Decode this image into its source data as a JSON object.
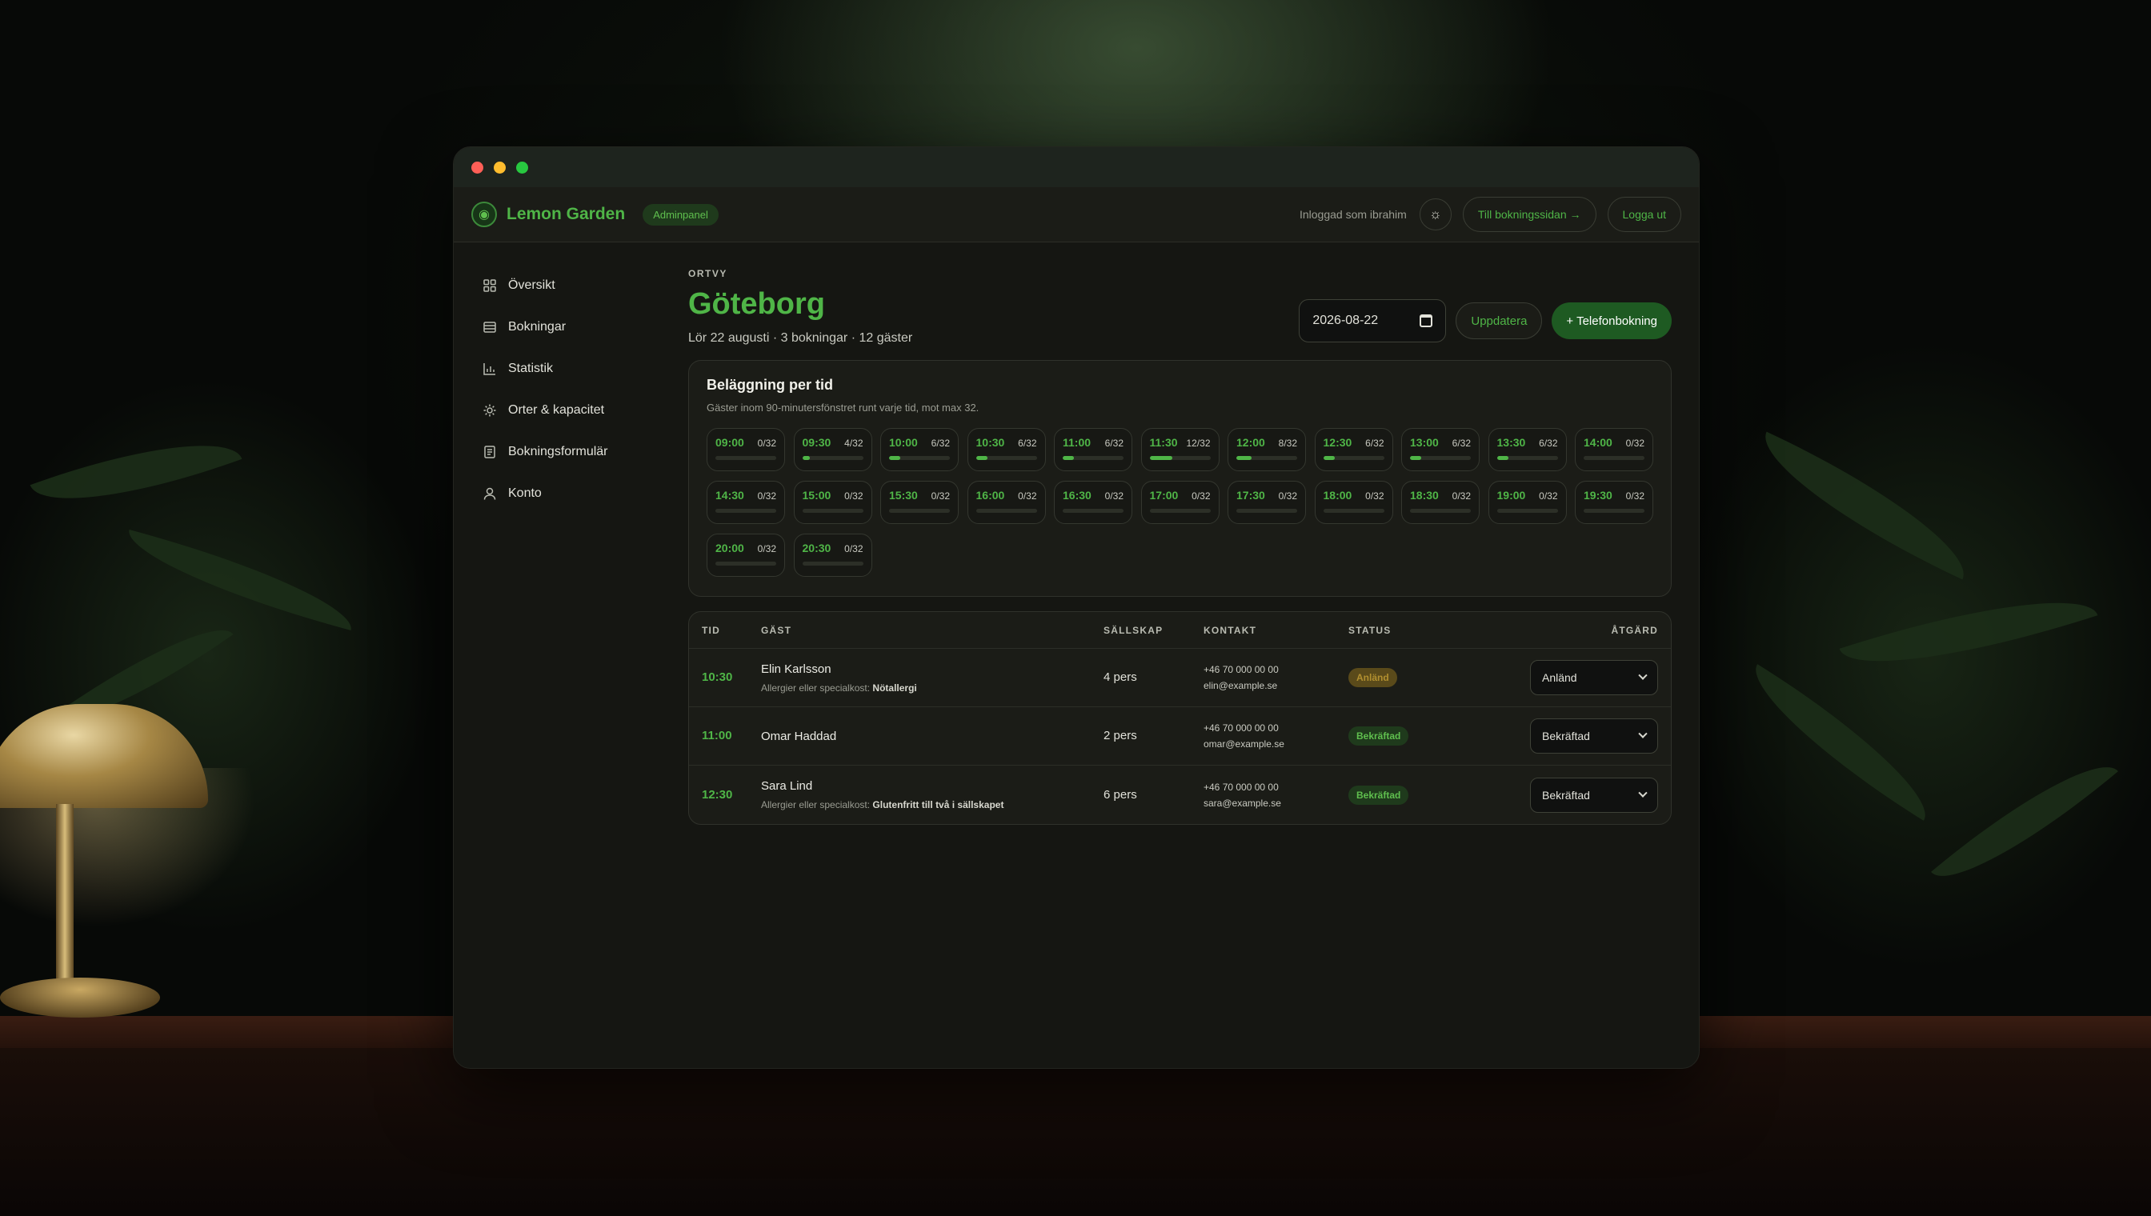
{
  "app": {
    "brand_name": "Lemon Garden",
    "brand_badge": "Adminpanel",
    "logged_in_text": "Inloggad som ibrahim",
    "to_booking_label": "Till bokningssidan →",
    "logout_label": "Logga ut"
  },
  "sidebar": {
    "items": [
      {
        "label": "Översikt",
        "icon": "grid-icon"
      },
      {
        "label": "Bokningar",
        "icon": "list-icon"
      },
      {
        "label": "Statistik",
        "icon": "chart-icon"
      },
      {
        "label": "Orter & kapacitet",
        "icon": "gear-icon"
      },
      {
        "label": "Bokningsformulär",
        "icon": "form-icon"
      },
      {
        "label": "Konto",
        "icon": "user-icon"
      }
    ]
  },
  "page": {
    "eyebrow": "ORTVY",
    "title": "Göteborg",
    "subtitle": "Lör 22 augusti · 3 bokningar · 12 gäster",
    "date_value": "2026-08-22",
    "refresh_label": "Uppdatera",
    "phone_booking_label": "+ Telefonbokning"
  },
  "capacity": {
    "title": "Beläggning per tid",
    "subtitle": "Gäster inom 90-minutersfönstret runt varje tid, mot max 32.",
    "max": 32,
    "slots": [
      {
        "time": "09:00",
        "count": "0/32",
        "guests": 0
      },
      {
        "time": "09:30",
        "count": "4/32",
        "guests": 4
      },
      {
        "time": "10:00",
        "count": "6/32",
        "guests": 6
      },
      {
        "time": "10:30",
        "count": "6/32",
        "guests": 6
      },
      {
        "time": "11:00",
        "count": "6/32",
        "guests": 6
      },
      {
        "time": "11:30",
        "count": "12/32",
        "guests": 12
      },
      {
        "time": "12:00",
        "count": "8/32",
        "guests": 8
      },
      {
        "time": "12:30",
        "count": "6/32",
        "guests": 6
      },
      {
        "time": "13:00",
        "count": "6/32",
        "guests": 6
      },
      {
        "time": "13:30",
        "count": "6/32",
        "guests": 6
      },
      {
        "time": "14:00",
        "count": "0/32",
        "guests": 0
      },
      {
        "time": "14:30",
        "count": "0/32",
        "guests": 0
      },
      {
        "time": "15:00",
        "count": "0/32",
        "guests": 0
      },
      {
        "time": "15:30",
        "count": "0/32",
        "guests": 0
      },
      {
        "time": "16:00",
        "count": "0/32",
        "guests": 0
      },
      {
        "time": "16:30",
        "count": "0/32",
        "guests": 0
      },
      {
        "time": "17:00",
        "count": "0/32",
        "guests": 0
      },
      {
        "time": "17:30",
        "count": "0/32",
        "guests": 0
      },
      {
        "time": "18:00",
        "count": "0/32",
        "guests": 0
      },
      {
        "time": "18:30",
        "count": "0/32",
        "guests": 0
      },
      {
        "time": "19:00",
        "count": "0/32",
        "guests": 0
      },
      {
        "time": "19:30",
        "count": "0/32",
        "guests": 0
      },
      {
        "time": "20:00",
        "count": "0/32",
        "guests": 0
      },
      {
        "time": "20:30",
        "count": "0/32",
        "guests": 0
      }
    ]
  },
  "bookings": {
    "headers": [
      "TID",
      "GÄST",
      "SÄLLSKAP",
      "KONTAKT",
      "STATUS",
      "ÅTGÄRD"
    ],
    "rows": [
      {
        "time": "10:30",
        "guest": "Elin Karlsson",
        "note_label": "Allergier eller specialkost:",
        "note_value": "Nötallergi",
        "party": "4 pers",
        "phone": "+46 70 000 00 00",
        "email": "elin@example.se",
        "status": "Anländ",
        "status_kind": "arrived",
        "action": "Anländ"
      },
      {
        "time": "11:00",
        "guest": "Omar Haddad",
        "note_label": "",
        "note_value": "",
        "party": "2 pers",
        "phone": "+46 70 000 00 00",
        "email": "omar@example.se",
        "status": "Bekräftad",
        "status_kind": "confirmed",
        "action": "Bekräftad"
      },
      {
        "time": "12:30",
        "guest": "Sara Lind",
        "note_label": "Allergier eller specialkost:",
        "note_value": "Glutenfritt till två i sällskapet",
        "party": "6 pers",
        "phone": "+46 70 000 00 00",
        "email": "sara@example.se",
        "status": "Bekräftad",
        "status_kind": "confirmed",
        "action": "Bekräftad"
      }
    ]
  },
  "colors": {
    "accent": "#4fb547",
    "primary_button": "#1e5a22",
    "arrived_badge": "#5a4a1a",
    "confirmed_badge": "#1f3a1c"
  }
}
